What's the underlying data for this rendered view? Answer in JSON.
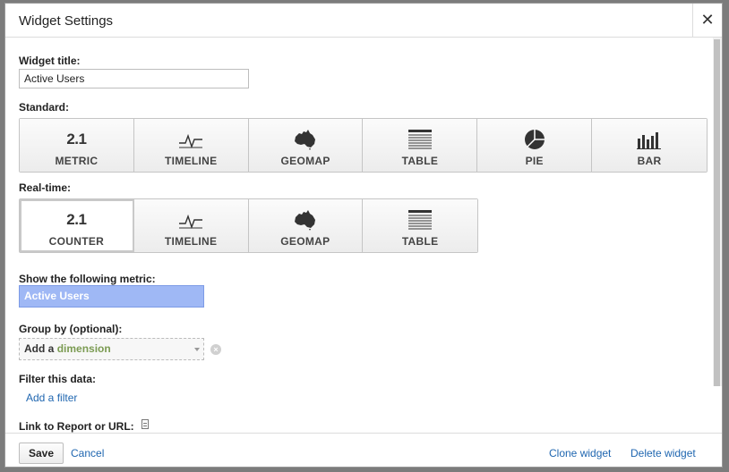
{
  "dialog": {
    "title": "Widget Settings",
    "close_glyph": "✕"
  },
  "form": {
    "widget_title_label": "Widget title:",
    "widget_title_value": "Active Users",
    "standard_label": "Standard:",
    "standard_types": [
      {
        "label": "METRIC",
        "icon": "metric-icon",
        "icon_text": "2.1",
        "selected": false
      },
      {
        "label": "TIMELINE",
        "icon": "timeline-icon",
        "selected": false
      },
      {
        "label": "GEOMAP",
        "icon": "geomap-icon",
        "selected": false
      },
      {
        "label": "TABLE",
        "icon": "table-icon",
        "selected": false
      },
      {
        "label": "PIE",
        "icon": "pie-icon",
        "selected": false
      },
      {
        "label": "BAR",
        "icon": "bar-icon",
        "selected": false
      }
    ],
    "realtime_label": "Real-time:",
    "realtime_types": [
      {
        "label": "COUNTER",
        "icon": "counter-icon",
        "icon_text": "2.1",
        "selected": true
      },
      {
        "label": "TIMELINE",
        "icon": "timeline-icon",
        "selected": false
      },
      {
        "label": "GEOMAP",
        "icon": "geomap-icon",
        "selected": false
      },
      {
        "label": "TABLE",
        "icon": "table-icon",
        "selected": false
      }
    ],
    "metric_label": "Show the following metric:",
    "metric_value": "Active Users",
    "group_by_label": "Group by (optional):",
    "dimension_prefix": "Add a",
    "dimension_word": "dimension",
    "filter_label": "Filter this data:",
    "add_filter_link": "Add a filter",
    "link_label": "Link to Report or URL:"
  },
  "footer": {
    "save_label": "Save",
    "cancel_label": "Cancel",
    "clone_label": "Clone widget",
    "delete_label": "Delete widget"
  },
  "colors": {
    "link": "#1f66b0",
    "metric_pill": "#9fb8f5",
    "dimension_text": "#7b9b52"
  }
}
